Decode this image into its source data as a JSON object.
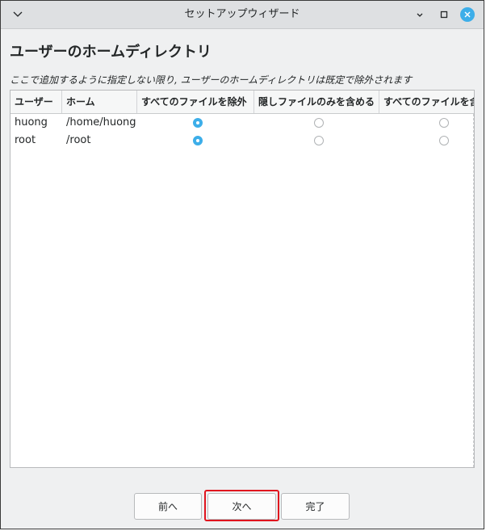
{
  "window": {
    "title": "セットアップウィザード"
  },
  "icons": {
    "menu": "chevron-down-icon",
    "minimize": "minimize-icon",
    "maximize": "maximize-icon",
    "close": "close-icon"
  },
  "page": {
    "title": "ユーザーのホームディレクトリ",
    "description": "ここで追加するように指定しない限り, ユーザーのホームディレクトリは既定で除外されます"
  },
  "table": {
    "columns": [
      "ユーザー",
      "ホーム",
      "すべてのファイルを除外",
      "隠しファイルのみを含める",
      "すべてのファイルを含める"
    ],
    "rows": [
      {
        "user": "huong",
        "home": "/home/huong",
        "selected": "exclude_all"
      },
      {
        "user": "root",
        "home": "/root",
        "selected": "exclude_all"
      }
    ]
  },
  "buttons": {
    "prev": "前へ",
    "next": "次へ",
    "finish": "完了"
  },
  "colors": {
    "accent": "#3daee9",
    "highlight": "#e0141e"
  }
}
